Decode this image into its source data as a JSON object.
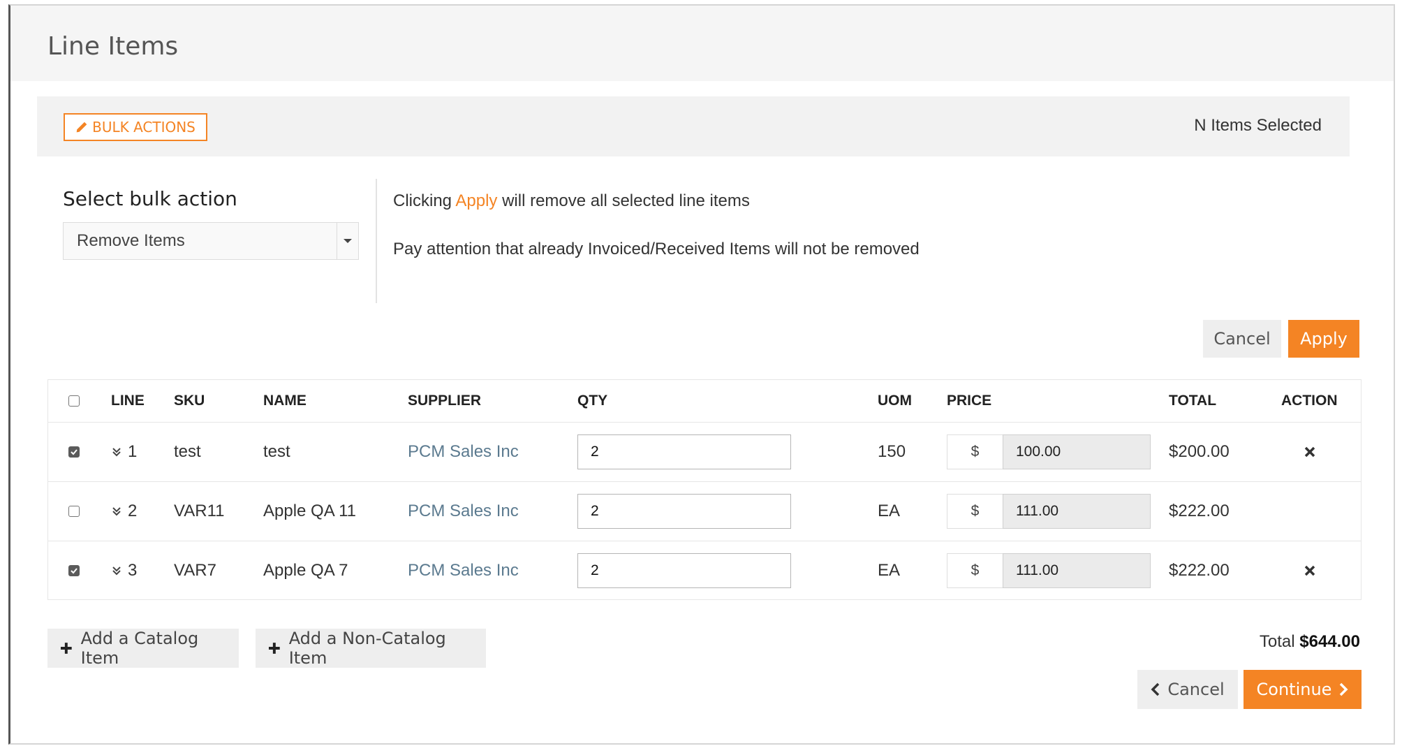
{
  "header": {
    "title": "Line Items"
  },
  "bulk": {
    "button_label": "BULK ACTIONS",
    "items_selected": "N Items Selected",
    "select_label": "Select bulk action",
    "select_value": "Remove Items",
    "info_prefix": "Clicking ",
    "info_apply": "Apply",
    "info_suffix": " will remove all selected line items",
    "info_note": "Pay attention that already Invoiced/Received Items will not be removed",
    "cancel_label": "Cancel",
    "apply_label": "Apply"
  },
  "table": {
    "headers": {
      "line": "LINE",
      "sku": "SKU",
      "name": "NAME",
      "supplier": "SUPPLIER",
      "qty": "QTY",
      "uom": "UOM",
      "price": "PRICE",
      "total": "TOTAL",
      "action": "ACTION"
    },
    "rows": [
      {
        "checked": true,
        "line": "1",
        "sku": "test",
        "name": "test",
        "supplier": "PCM Sales Inc",
        "qty": "2",
        "uom": "150",
        "currency": "$",
        "price": "100.00",
        "total": "$200.00",
        "removable": true
      },
      {
        "checked": false,
        "line": "2",
        "sku": "VAR11",
        "name": "Apple QA 11",
        "supplier": "PCM Sales Inc",
        "qty": "2",
        "uom": "EA",
        "currency": "$",
        "price": "111.00",
        "total": "$222.00",
        "removable": false
      },
      {
        "checked": true,
        "line": "3",
        "sku": "VAR7",
        "name": "Apple QA 7",
        "supplier": "PCM Sales Inc",
        "qty": "2",
        "uom": "EA",
        "currency": "$",
        "price": "111.00",
        "total": "$222.00",
        "removable": true
      }
    ]
  },
  "footer": {
    "add_catalog": "Add a Catalog Item",
    "add_non_catalog": "Add a Non-Catalog Item",
    "total_label": "Total",
    "total_value": "$644.00",
    "cancel_label": "Cancel",
    "continue_label": "Continue"
  },
  "colors": {
    "accent": "#f48424",
    "supplier_link": "#5b7a8f",
    "header_bg": "#f5f5f5"
  }
}
